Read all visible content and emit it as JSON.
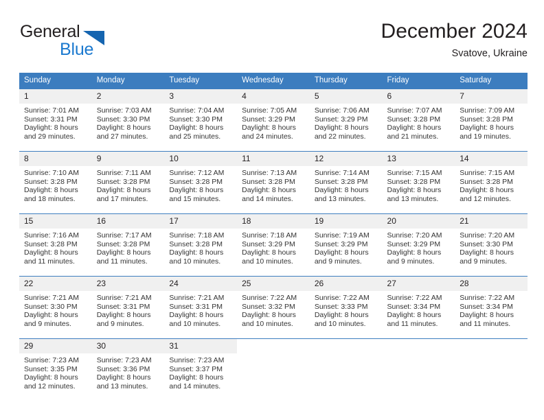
{
  "brand": {
    "name_part1": "General",
    "name_part2": "Blue",
    "triangle_color": "#1565b0",
    "blue_color": "#1b79cf"
  },
  "header": {
    "title": "December 2024",
    "location": "Svatove, Ukraine"
  },
  "calendar": {
    "header_bg": "#3c7dbf",
    "daynum_bg": "#f0f0f0",
    "weekday_names": [
      "Sunday",
      "Monday",
      "Tuesday",
      "Wednesday",
      "Thursday",
      "Friday",
      "Saturday"
    ],
    "weeks": [
      [
        {
          "day": "1",
          "sunrise": "Sunrise: 7:01 AM",
          "sunset": "Sunset: 3:31 PM",
          "daylight_1": "Daylight: 8 hours",
          "daylight_2": "and 29 minutes."
        },
        {
          "day": "2",
          "sunrise": "Sunrise: 7:03 AM",
          "sunset": "Sunset: 3:30 PM",
          "daylight_1": "Daylight: 8 hours",
          "daylight_2": "and 27 minutes."
        },
        {
          "day": "3",
          "sunrise": "Sunrise: 7:04 AM",
          "sunset": "Sunset: 3:30 PM",
          "daylight_1": "Daylight: 8 hours",
          "daylight_2": "and 25 minutes."
        },
        {
          "day": "4",
          "sunrise": "Sunrise: 7:05 AM",
          "sunset": "Sunset: 3:29 PM",
          "daylight_1": "Daylight: 8 hours",
          "daylight_2": "and 24 minutes."
        },
        {
          "day": "5",
          "sunrise": "Sunrise: 7:06 AM",
          "sunset": "Sunset: 3:29 PM",
          "daylight_1": "Daylight: 8 hours",
          "daylight_2": "and 22 minutes."
        },
        {
          "day": "6",
          "sunrise": "Sunrise: 7:07 AM",
          "sunset": "Sunset: 3:28 PM",
          "daylight_1": "Daylight: 8 hours",
          "daylight_2": "and 21 minutes."
        },
        {
          "day": "7",
          "sunrise": "Sunrise: 7:09 AM",
          "sunset": "Sunset: 3:28 PM",
          "daylight_1": "Daylight: 8 hours",
          "daylight_2": "and 19 minutes."
        }
      ],
      [
        {
          "day": "8",
          "sunrise": "Sunrise: 7:10 AM",
          "sunset": "Sunset: 3:28 PM",
          "daylight_1": "Daylight: 8 hours",
          "daylight_2": "and 18 minutes."
        },
        {
          "day": "9",
          "sunrise": "Sunrise: 7:11 AM",
          "sunset": "Sunset: 3:28 PM",
          "daylight_1": "Daylight: 8 hours",
          "daylight_2": "and 17 minutes."
        },
        {
          "day": "10",
          "sunrise": "Sunrise: 7:12 AM",
          "sunset": "Sunset: 3:28 PM",
          "daylight_1": "Daylight: 8 hours",
          "daylight_2": "and 15 minutes."
        },
        {
          "day": "11",
          "sunrise": "Sunrise: 7:13 AM",
          "sunset": "Sunset: 3:28 PM",
          "daylight_1": "Daylight: 8 hours",
          "daylight_2": "and 14 minutes."
        },
        {
          "day": "12",
          "sunrise": "Sunrise: 7:14 AM",
          "sunset": "Sunset: 3:28 PM",
          "daylight_1": "Daylight: 8 hours",
          "daylight_2": "and 13 minutes."
        },
        {
          "day": "13",
          "sunrise": "Sunrise: 7:15 AM",
          "sunset": "Sunset: 3:28 PM",
          "daylight_1": "Daylight: 8 hours",
          "daylight_2": "and 13 minutes."
        },
        {
          "day": "14",
          "sunrise": "Sunrise: 7:15 AM",
          "sunset": "Sunset: 3:28 PM",
          "daylight_1": "Daylight: 8 hours",
          "daylight_2": "and 12 minutes."
        }
      ],
      [
        {
          "day": "15",
          "sunrise": "Sunrise: 7:16 AM",
          "sunset": "Sunset: 3:28 PM",
          "daylight_1": "Daylight: 8 hours",
          "daylight_2": "and 11 minutes."
        },
        {
          "day": "16",
          "sunrise": "Sunrise: 7:17 AM",
          "sunset": "Sunset: 3:28 PM",
          "daylight_1": "Daylight: 8 hours",
          "daylight_2": "and 11 minutes."
        },
        {
          "day": "17",
          "sunrise": "Sunrise: 7:18 AM",
          "sunset": "Sunset: 3:28 PM",
          "daylight_1": "Daylight: 8 hours",
          "daylight_2": "and 10 minutes."
        },
        {
          "day": "18",
          "sunrise": "Sunrise: 7:18 AM",
          "sunset": "Sunset: 3:29 PM",
          "daylight_1": "Daylight: 8 hours",
          "daylight_2": "and 10 minutes."
        },
        {
          "day": "19",
          "sunrise": "Sunrise: 7:19 AM",
          "sunset": "Sunset: 3:29 PM",
          "daylight_1": "Daylight: 8 hours",
          "daylight_2": "and 9 minutes."
        },
        {
          "day": "20",
          "sunrise": "Sunrise: 7:20 AM",
          "sunset": "Sunset: 3:29 PM",
          "daylight_1": "Daylight: 8 hours",
          "daylight_2": "and 9 minutes."
        },
        {
          "day": "21",
          "sunrise": "Sunrise: 7:20 AM",
          "sunset": "Sunset: 3:30 PM",
          "daylight_1": "Daylight: 8 hours",
          "daylight_2": "and 9 minutes."
        }
      ],
      [
        {
          "day": "22",
          "sunrise": "Sunrise: 7:21 AM",
          "sunset": "Sunset: 3:30 PM",
          "daylight_1": "Daylight: 8 hours",
          "daylight_2": "and 9 minutes."
        },
        {
          "day": "23",
          "sunrise": "Sunrise: 7:21 AM",
          "sunset": "Sunset: 3:31 PM",
          "daylight_1": "Daylight: 8 hours",
          "daylight_2": "and 9 minutes."
        },
        {
          "day": "24",
          "sunrise": "Sunrise: 7:21 AM",
          "sunset": "Sunset: 3:31 PM",
          "daylight_1": "Daylight: 8 hours",
          "daylight_2": "and 10 minutes."
        },
        {
          "day": "25",
          "sunrise": "Sunrise: 7:22 AM",
          "sunset": "Sunset: 3:32 PM",
          "daylight_1": "Daylight: 8 hours",
          "daylight_2": "and 10 minutes."
        },
        {
          "day": "26",
          "sunrise": "Sunrise: 7:22 AM",
          "sunset": "Sunset: 3:33 PM",
          "daylight_1": "Daylight: 8 hours",
          "daylight_2": "and 10 minutes."
        },
        {
          "day": "27",
          "sunrise": "Sunrise: 7:22 AM",
          "sunset": "Sunset: 3:34 PM",
          "daylight_1": "Daylight: 8 hours",
          "daylight_2": "and 11 minutes."
        },
        {
          "day": "28",
          "sunrise": "Sunrise: 7:22 AM",
          "sunset": "Sunset: 3:34 PM",
          "daylight_1": "Daylight: 8 hours",
          "daylight_2": "and 11 minutes."
        }
      ],
      [
        {
          "day": "29",
          "sunrise": "Sunrise: 7:23 AM",
          "sunset": "Sunset: 3:35 PM",
          "daylight_1": "Daylight: 8 hours",
          "daylight_2": "and 12 minutes."
        },
        {
          "day": "30",
          "sunrise": "Sunrise: 7:23 AM",
          "sunset": "Sunset: 3:36 PM",
          "daylight_1": "Daylight: 8 hours",
          "daylight_2": "and 13 minutes."
        },
        {
          "day": "31",
          "sunrise": "Sunrise: 7:23 AM",
          "sunset": "Sunset: 3:37 PM",
          "daylight_1": "Daylight: 8 hours",
          "daylight_2": "and 14 minutes."
        },
        {
          "day": "",
          "sunrise": "",
          "sunset": "",
          "daylight_1": "",
          "daylight_2": ""
        },
        {
          "day": "",
          "sunrise": "",
          "sunset": "",
          "daylight_1": "",
          "daylight_2": ""
        },
        {
          "day": "",
          "sunrise": "",
          "sunset": "",
          "daylight_1": "",
          "daylight_2": ""
        },
        {
          "day": "",
          "sunrise": "",
          "sunset": "",
          "daylight_1": "",
          "daylight_2": ""
        }
      ]
    ]
  }
}
